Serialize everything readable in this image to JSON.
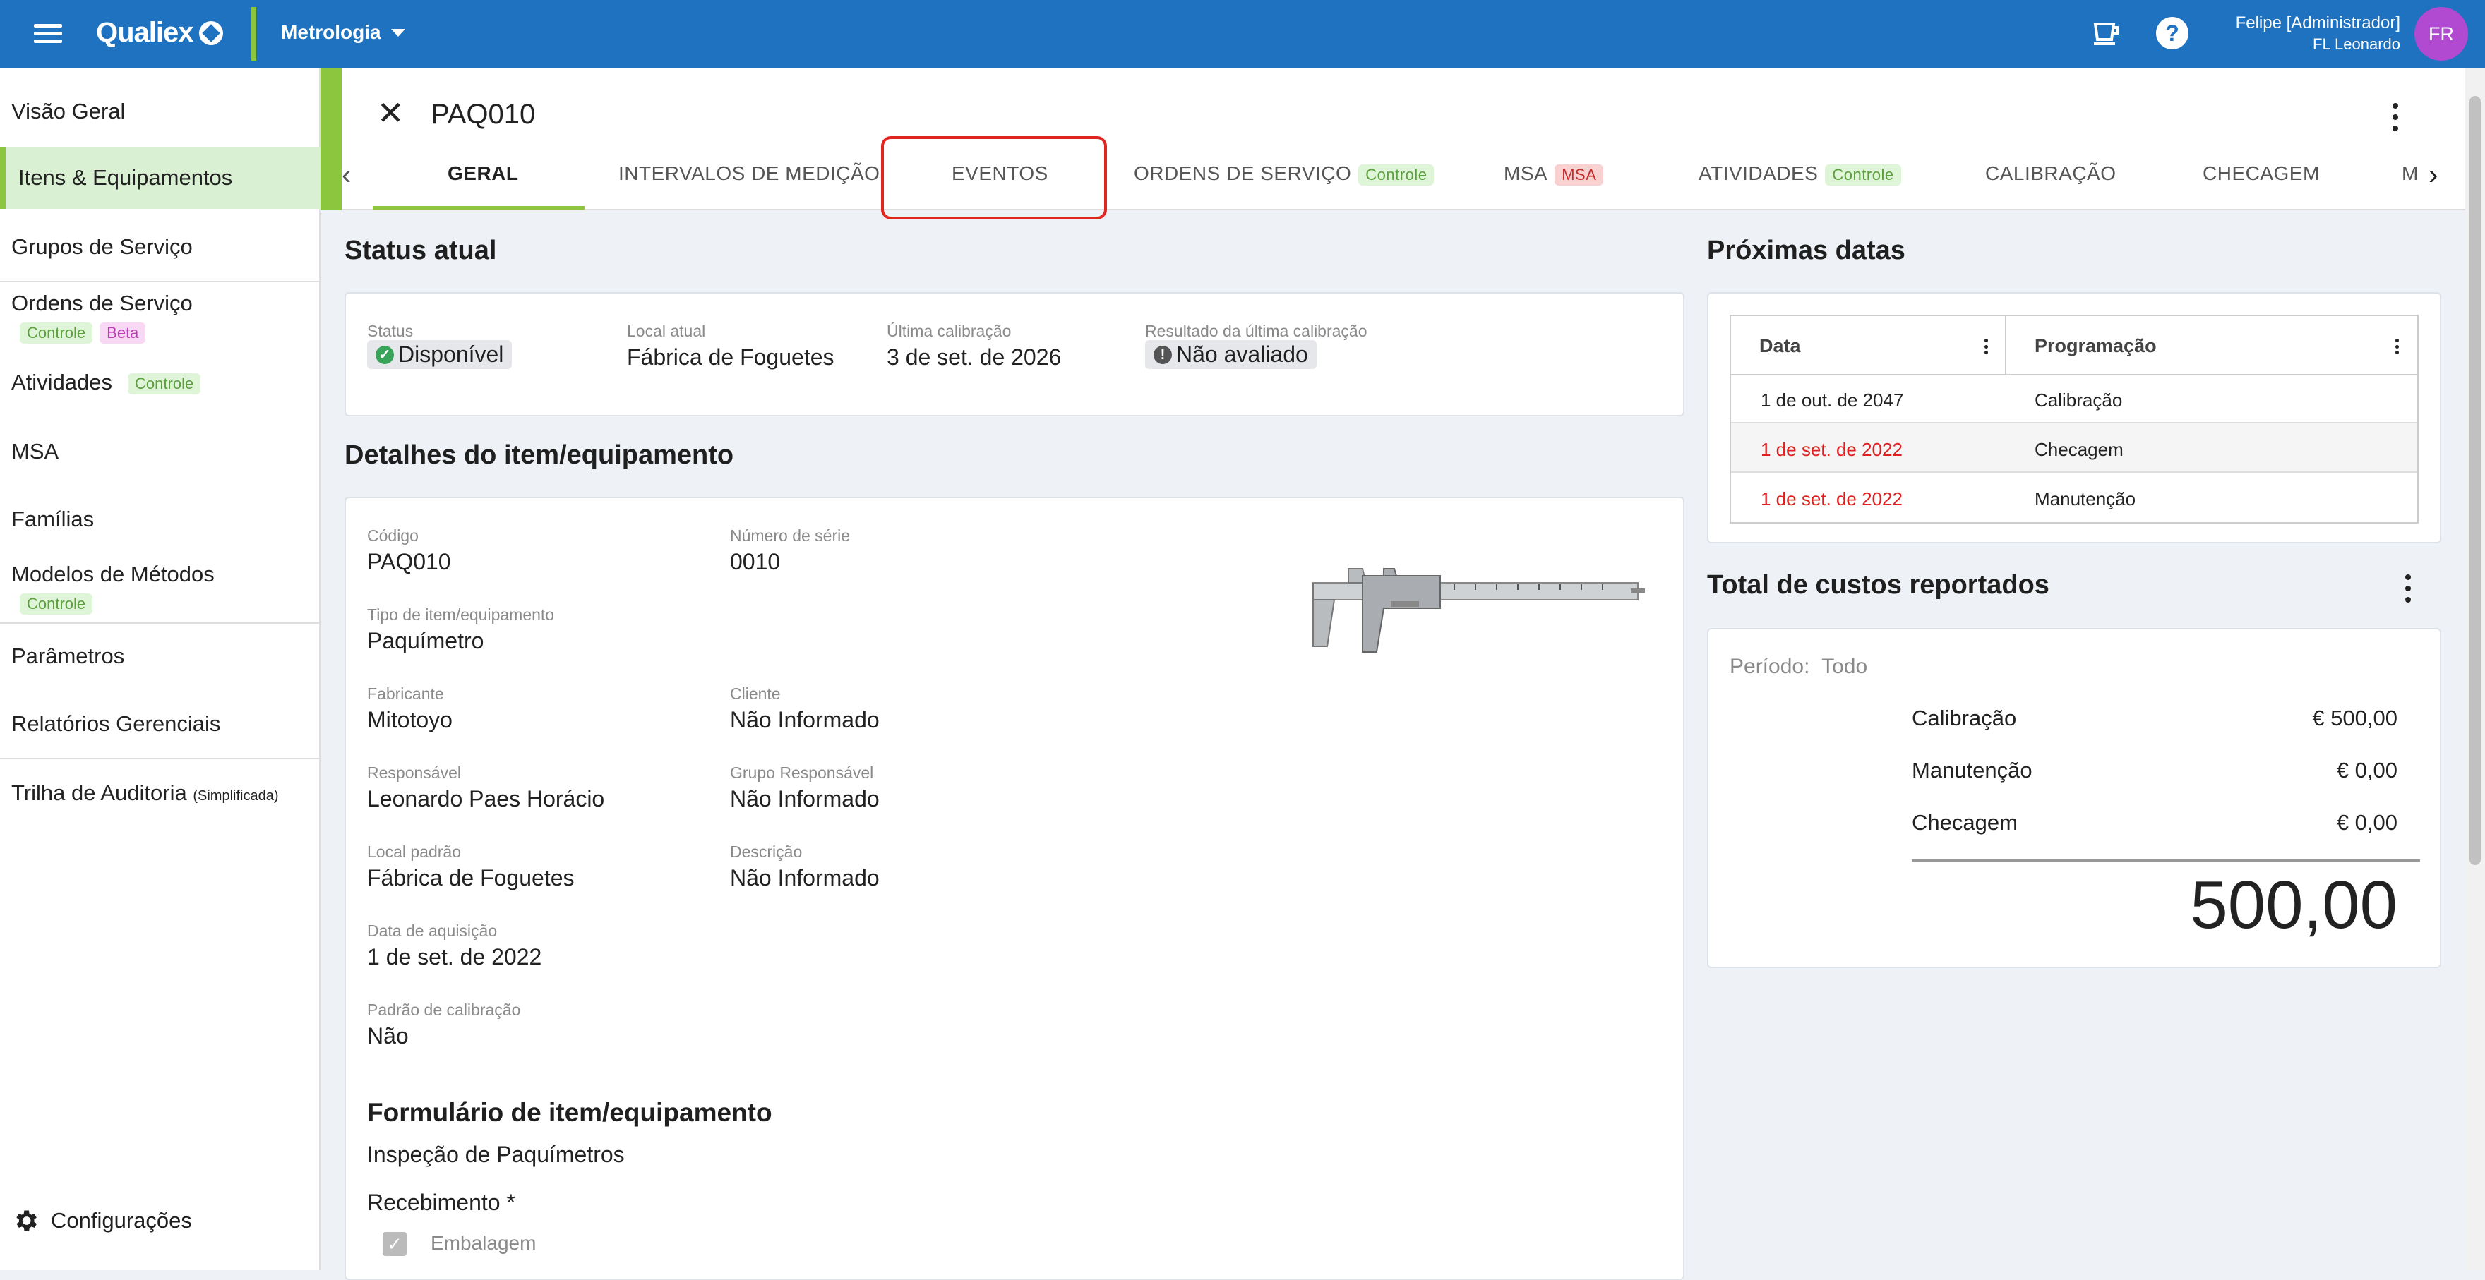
{
  "topbar": {
    "app_name": "Qualiex",
    "module": "Metrologia",
    "user_name": "Felipe [Administrador]",
    "user_sub": "FL Leonardo",
    "avatar": "FR",
    "help": "?"
  },
  "sidebar": {
    "items": [
      {
        "label": "Visão Geral"
      },
      {
        "label": "Itens & Equipamentos"
      },
      {
        "label": "Grupos de Serviço"
      },
      {
        "label": "Ordens de Serviço",
        "tags": [
          "Controle",
          "Beta"
        ]
      },
      {
        "label": "Atividades",
        "tags": [
          "Controle"
        ]
      },
      {
        "label": "MSA"
      },
      {
        "label": "Famílias"
      },
      {
        "label": "Modelos de Métodos",
        "tags": [
          "Controle"
        ]
      },
      {
        "label": "Parâmetros"
      },
      {
        "label": "Relatórios Gerenciais"
      },
      {
        "label": "Trilha de Auditoria",
        "suffix": "(Simplificada)"
      }
    ],
    "config_label": "Configurações"
  },
  "header": {
    "title": "PAQ010",
    "tabs": [
      {
        "label": "GERAL"
      },
      {
        "label": "INTERVALOS DE MEDIÇÃO"
      },
      {
        "label": "EVENTOS"
      },
      {
        "label": "ORDENS DE SERVIÇO",
        "tag": "Controle"
      },
      {
        "label": "MSA",
        "tag": "MSA"
      },
      {
        "label": "ATIVIDADES",
        "tag": "Controle"
      },
      {
        "label": "CALIBRAÇÃO"
      },
      {
        "label": "CHECAGEM"
      },
      {
        "label": "M"
      }
    ]
  },
  "status": {
    "title": "Status atual",
    "status_label": "Status",
    "status_value": "Disponível",
    "local_label": "Local atual",
    "local_value": "Fábrica de Foguetes",
    "calib_label": "Última calibração",
    "calib_value": "3 de set. de 2026",
    "result_label": "Resultado da última calibração",
    "result_value": "Não avaliado"
  },
  "details": {
    "title": "Detalhes do item/equipamento",
    "fields": [
      {
        "label": "Código",
        "value": "PAQ010"
      },
      {
        "label": "Número de série",
        "value": "0010"
      },
      {
        "label": "Tipo de item/equipamento",
        "value": "Paquímetro"
      },
      {
        "label": "Fabricante",
        "value": "Mitotoyo"
      },
      {
        "label": "Cliente",
        "value": "Não Informado"
      },
      {
        "label": "Responsável",
        "value": "Leonardo Paes Horácio"
      },
      {
        "label": "Grupo Responsável",
        "value": "Não Informado"
      },
      {
        "label": "Local padrão",
        "value": "Fábrica de Foguetes"
      },
      {
        "label": "Descrição",
        "value": "Não Informado"
      },
      {
        "label": "Data de aquisição",
        "value": "1 de set. de 2022"
      },
      {
        "label": "Padrão de calibração",
        "value": "Não"
      }
    ],
    "form_title": "Formulário de item/equipamento",
    "form_name": "Inspeção de Paquímetros",
    "form_section": "Recebimento *",
    "form_item": "Embalagem"
  },
  "next_dates": {
    "title": "Próximas datas",
    "columns": [
      "Data",
      "Programação"
    ],
    "rows": [
      {
        "date": "1 de out. de 2047",
        "prog": "Calibração",
        "overdue": false
      },
      {
        "date": "1 de set. de 2022",
        "prog": "Checagem",
        "overdue": true
      },
      {
        "date": "1 de set. de 2022",
        "prog": "Manutenção",
        "overdue": true
      }
    ]
  },
  "costs": {
    "title": "Total de custos reportados",
    "period_label": "Período:",
    "period_value": "Todo",
    "items": [
      {
        "label": "Calibração",
        "value": "€ 500,00"
      },
      {
        "label": "Manutenção",
        "value": "€ 0,00"
      },
      {
        "label": "Checagem",
        "value": "€ 0,00"
      }
    ],
    "total": "500,00"
  },
  "colors": {
    "brand": "#1e72c0",
    "accent": "#8cc63f",
    "overdue": "#e02020",
    "ok": "#3aa35a",
    "highlight": "#e0251f"
  }
}
